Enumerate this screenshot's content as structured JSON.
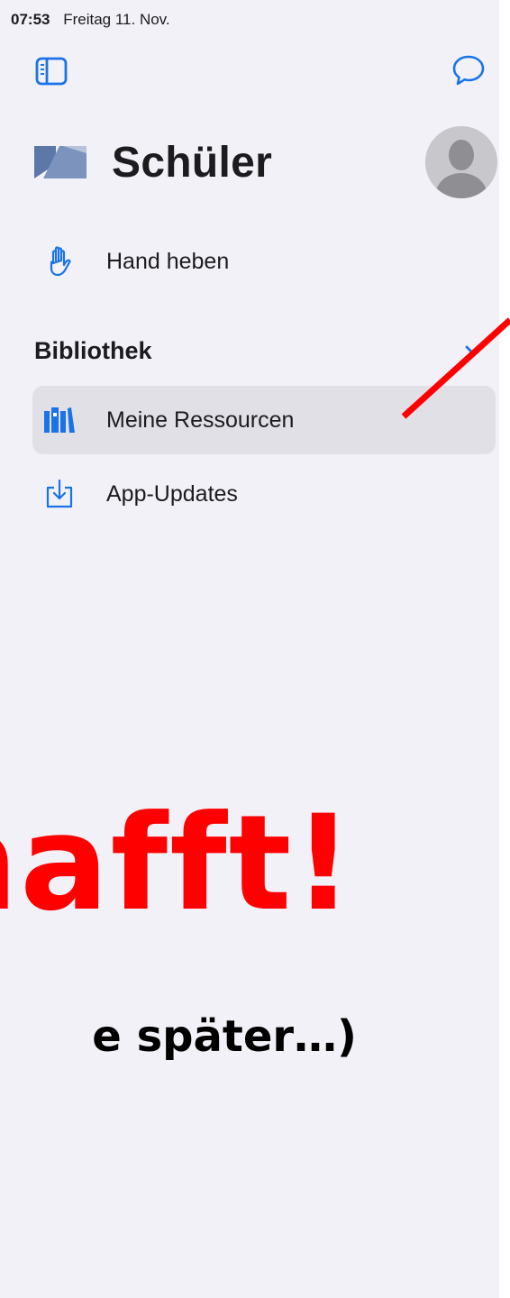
{
  "statusbar": {
    "time": "07:53",
    "date": "Freitag 11. Nov."
  },
  "toolbar": {
    "sidebar_icon": "sidebar-icon",
    "chat_icon": "chat-bubble-icon"
  },
  "header": {
    "title": "Schüler",
    "logo_icon": "classroom-logo-icon",
    "avatar_icon": "person-avatar-icon"
  },
  "menu": {
    "hand_raise": {
      "label": "Hand heben",
      "icon": "hand-raised-icon"
    },
    "library_section": {
      "title": "Bibliothek",
      "icon": "chevron-down-icon"
    },
    "my_resources": {
      "label": "Meine Ressourcen",
      "icon": "books-icon",
      "selected": true
    },
    "app_updates": {
      "label": "App-Updates",
      "icon": "download-tray-icon"
    }
  },
  "overlay": {
    "headline": "hafft!",
    "subline": "e später…)",
    "headline_color": "#ff0000",
    "arrow_color": "#ff0000"
  },
  "colors": {
    "accent": "#1a73e8",
    "sidebar_bg": "#f2f1f7",
    "selected_row": "#e1e0e6"
  }
}
